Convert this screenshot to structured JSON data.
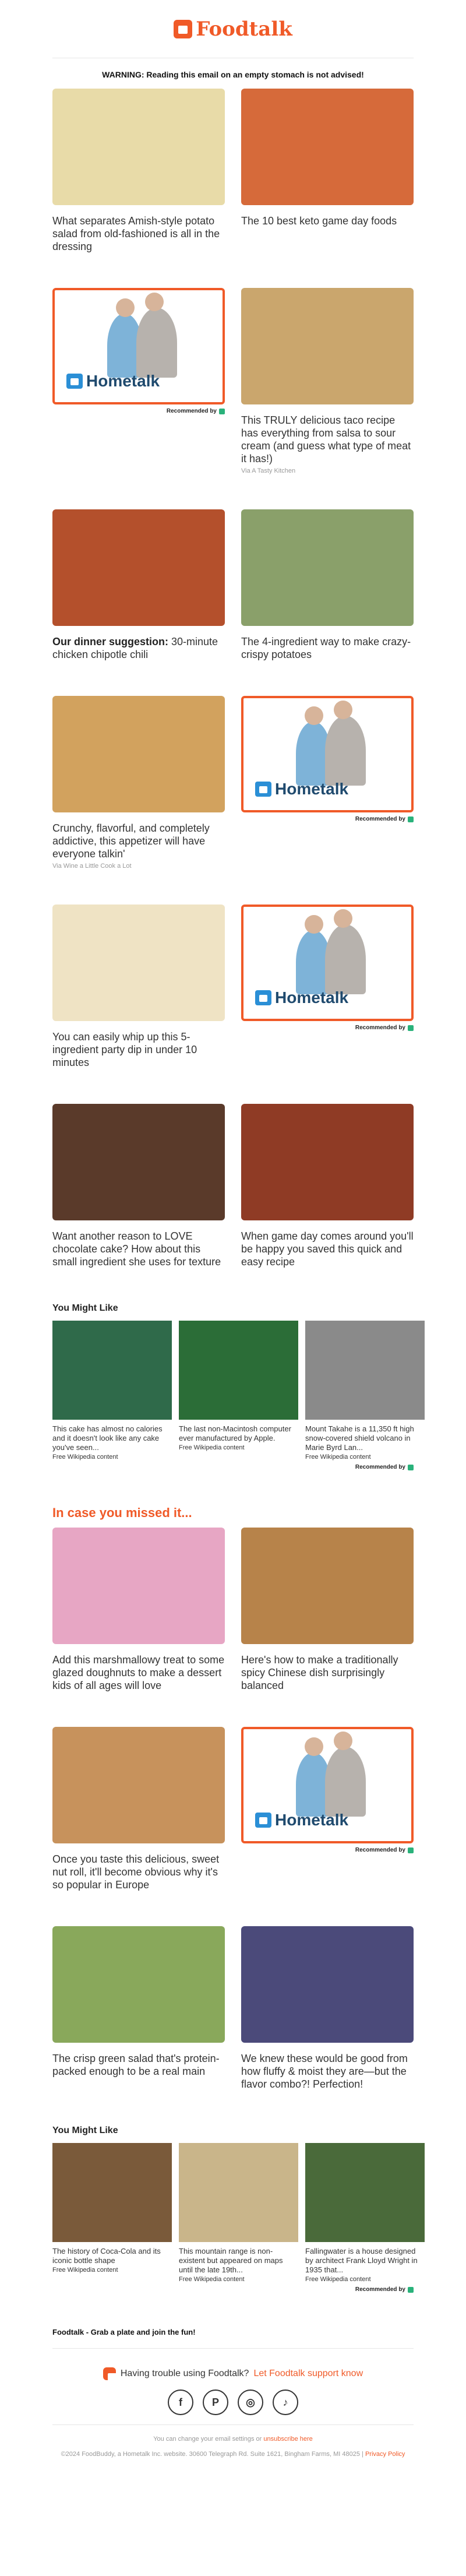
{
  "brand": {
    "name": "Foodtalk",
    "accent": "#f05a28"
  },
  "warning": "WARNING: Reading this email on an empty stomach is not advised!",
  "rows": [
    [
      {
        "caption": "What separates Amish-style potato salad from old-fashioned is all in the dressing",
        "via": "",
        "color": "#e8dba8"
      },
      {
        "caption": "The 10 best keto game day foods",
        "via": "",
        "color": "#d66a3a"
      }
    ],
    [
      {
        "ad": true,
        "rec": "Recommended by"
      },
      {
        "caption": "This TRULY delicious taco recipe has everything from salsa to sour cream (and guess what type of meat it has!)",
        "via": "Via A Tasty Kitchen",
        "color": "#caa66d"
      }
    ],
    [
      {
        "caption_bold": "Our dinner suggestion:",
        "caption": " 30-minute chicken chipotle chili",
        "via": "",
        "color": "#b4502c"
      },
      {
        "caption": "The 4-ingredient way to make crazy-crispy potatoes",
        "via": "",
        "color": "#8aa06a"
      }
    ],
    [
      {
        "caption": "Crunchy, flavorful, and completely addictive, this appetizer will have everyone talkin'",
        "via": "Via Wine a Little Cook a Lot",
        "color": "#d2a25e"
      },
      {
        "ad": true,
        "rec": "Recommended by"
      }
    ],
    [
      {
        "caption": "You can easily whip up this 5-ingredient party dip in under 10 minutes",
        "via": "",
        "color": "#efe3c4"
      },
      {
        "ad": true,
        "rec": "Recommended by"
      }
    ],
    [
      {
        "caption": "Want another reason to LOVE chocolate cake? How about this small ingredient she uses for texture",
        "via": "",
        "color": "#5a3a2a"
      },
      {
        "caption": "When game day comes around you'll be happy you saved this quick and easy recipe",
        "via": "",
        "color": "#8f3b25"
      }
    ]
  ],
  "you_might_like_1": {
    "title": "You Might Like",
    "items": [
      {
        "caption": "This cake has almost no calories and it doesn't look like any cake you've seen...",
        "via": "Free Wikipedia content",
        "color": "#2f6a4a"
      },
      {
        "caption": "The last non-Macintosh computer ever manufactured by Apple.",
        "via": "Free Wikipedia content",
        "color": "#2b6d37"
      },
      {
        "caption": "Mount Takahe is a 11,350 ft high snow-covered shield volcano in Marie Byrd Lan...",
        "via": "Free Wikipedia content",
        "color": "#8a8a8a"
      }
    ],
    "rec": "Recommended by"
  },
  "missed": {
    "title": "In case you missed it...",
    "rows": [
      [
        {
          "caption": "Add this marshmallowy treat to some glazed doughnuts to make a dessert kids of all ages will love",
          "via": "",
          "color": "#e7a6c4"
        },
        {
          "caption": "Here's how to make a traditionally spicy Chinese dish surprisingly balanced",
          "via": "",
          "color": "#b7834a"
        }
      ],
      [
        {
          "caption": "Once you taste this delicious, sweet nut roll, it'll become obvious why it's so popular in Europe",
          "via": "",
          "color": "#c7925c"
        },
        {
          "ad": true,
          "rec": "Recommended by"
        }
      ],
      [
        {
          "caption": "The crisp green salad that's protein-packed enough to be a real main",
          "via": "",
          "color": "#89a85b"
        },
        {
          "caption": "We knew these would be good from how fluffy & moist they are—but the flavor combo?! Perfection!",
          "via": "",
          "color": "#4b4a7a"
        }
      ]
    ]
  },
  "you_might_like_2": {
    "title": "You Might Like",
    "items": [
      {
        "caption": "The history of Coca-Cola and its iconic bottle shape",
        "via": "Free Wikipedia content",
        "color": "#7a5a3a"
      },
      {
        "caption": "This mountain range is non-existent but appeared on maps until the late 19th...",
        "via": "Free Wikipedia content",
        "color": "#c9b58a"
      },
      {
        "caption": "Fallingwater is a house designed by architect Frank Lloyd Wright in 1935 that...",
        "via": "Free Wikipedia content",
        "color": "#4a6a3a"
      }
    ],
    "rec": "Recommended by"
  },
  "hometalk_label": "Hometalk",
  "footer": {
    "tagline": "Foodtalk - Grab a plate and join the fun!",
    "support_text": "Having trouble using Foodtalk?",
    "support_link": "Let Foodtalk support know",
    "social": [
      "f",
      "P",
      "◎",
      "♪"
    ],
    "social_icons": [
      "facebook-icon",
      "pinterest-icon",
      "instagram-icon",
      "tiktok-icon"
    ],
    "settings_text": "You can change your email settings or",
    "unsubscribe": "unsubscribe here",
    "address": "©2024 FoodBuddy, a Hometalk Inc. website. 30600 Telegraph Rd. Suite 1621, Bingham Farms, MI 48025",
    "privacy": "Privacy Policy"
  }
}
